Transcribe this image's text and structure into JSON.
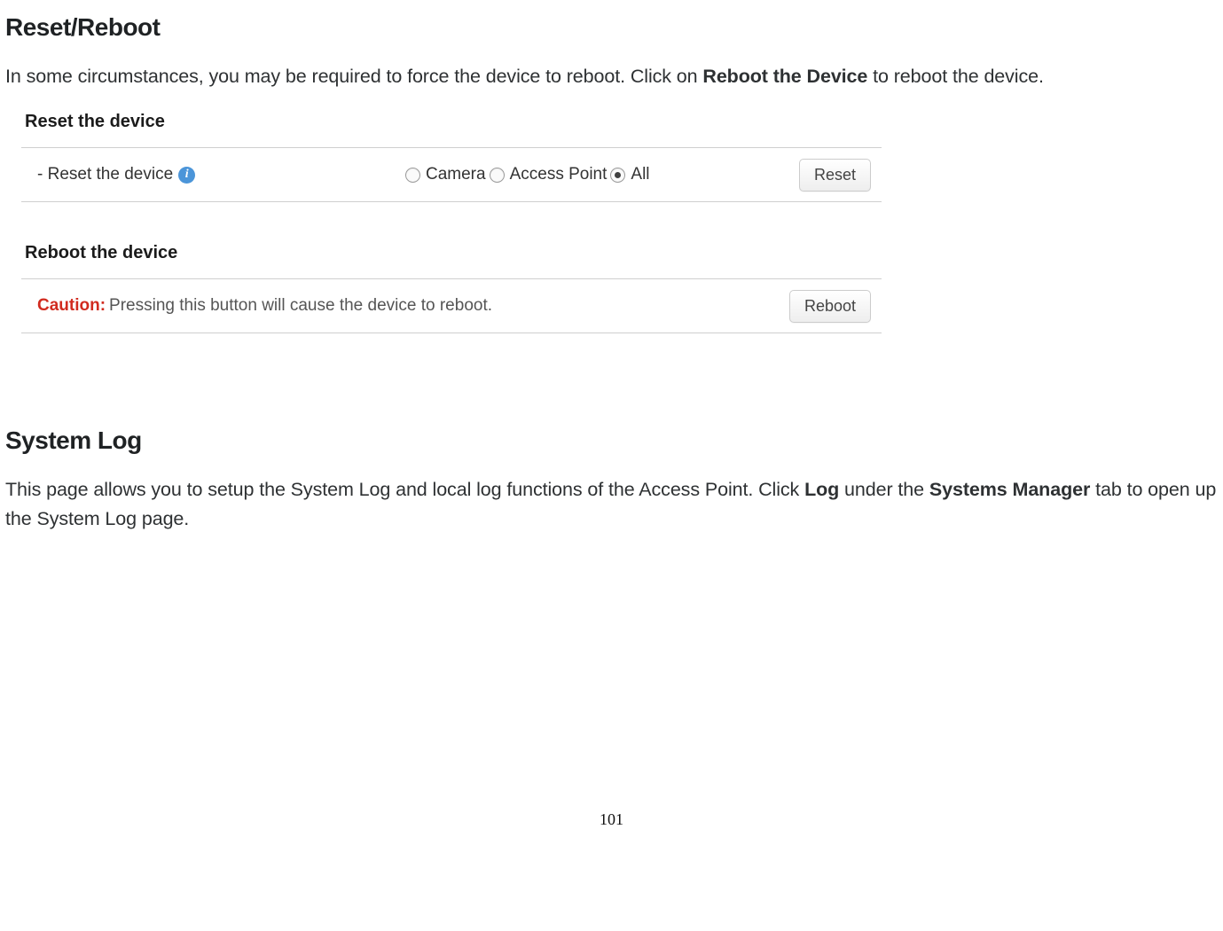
{
  "section1": {
    "heading": "Reset/Reboot",
    "text_part1": "In some circumstances, you may be required to force the device to reboot. Click on ",
    "text_bold": "Reboot the Device",
    "text_part2": " to reboot the device."
  },
  "screenshot": {
    "reset_panel_title": "Reset the device",
    "reset_row_label": "- Reset the device",
    "info_icon_glyph": "i",
    "radio_options": {
      "camera": "Camera",
      "access_point": "Access Point",
      "all": "All",
      "selected": "all"
    },
    "reset_button": "Reset",
    "reboot_panel_title": "Reboot the device",
    "caution_label": "Caution:",
    "caution_message": " Pressing this button will cause the device to reboot.",
    "reboot_button": "Reboot"
  },
  "section2": {
    "heading": "System Log",
    "text_part1": "This page allows you to setup the System Log and local log functions of the Access Point. Click ",
    "text_bold1": "Log",
    "text_part2": " under the ",
    "text_bold2": "Systems Manager",
    "text_part3": " tab to open up the System Log page."
  },
  "page_number": "101"
}
